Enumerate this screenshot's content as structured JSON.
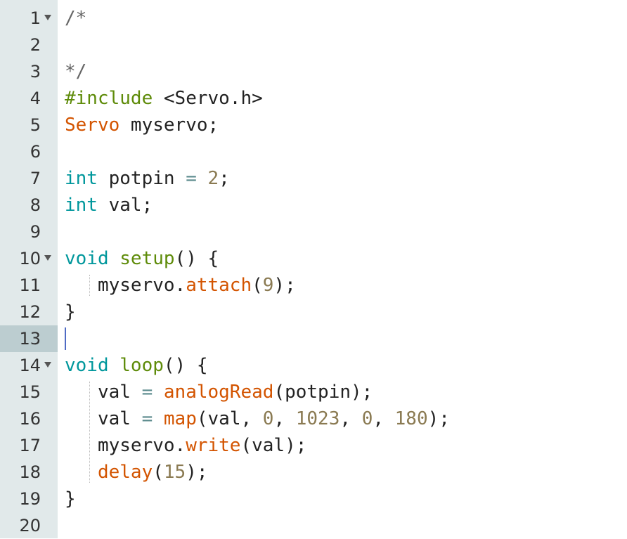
{
  "editor": {
    "lines": [
      {
        "n": "1",
        "fold": true,
        "segs": [
          {
            "t": "/*",
            "c": "comment"
          }
        ]
      },
      {
        "n": "2",
        "fold": false,
        "segs": []
      },
      {
        "n": "3",
        "fold": false,
        "segs": [
          {
            "t": "*/",
            "c": "comment"
          }
        ]
      },
      {
        "n": "4",
        "fold": false,
        "segs": [
          {
            "t": "#include",
            "c": "pre"
          },
          {
            "t": " <Servo.h>",
            "c": ""
          }
        ]
      },
      {
        "n": "5",
        "fold": false,
        "segs": [
          {
            "t": "Servo",
            "c": "type"
          },
          {
            "t": " myservo;",
            "c": ""
          }
        ]
      },
      {
        "n": "6",
        "fold": false,
        "segs": []
      },
      {
        "n": "7",
        "fold": false,
        "segs": [
          {
            "t": "int",
            "c": "kw"
          },
          {
            "t": " potpin ",
            "c": ""
          },
          {
            "t": "=",
            "c": "op"
          },
          {
            "t": " ",
            "c": ""
          },
          {
            "t": "2",
            "c": "num"
          },
          {
            "t": ";",
            "c": ""
          }
        ]
      },
      {
        "n": "8",
        "fold": false,
        "segs": [
          {
            "t": "int",
            "c": "kw"
          },
          {
            "t": " val;",
            "c": ""
          }
        ]
      },
      {
        "n": "9",
        "fold": false,
        "segs": []
      },
      {
        "n": "10",
        "fold": true,
        "segs": [
          {
            "t": "void",
            "c": "kw"
          },
          {
            "t": " ",
            "c": ""
          },
          {
            "t": "setup",
            "c": "fn"
          },
          {
            "t": "() {",
            "c": ""
          }
        ]
      },
      {
        "n": "11",
        "fold": false,
        "segs": [
          {
            "t": "   myservo.",
            "c": ""
          },
          {
            "t": "attach",
            "c": "call"
          },
          {
            "t": "(",
            "c": ""
          },
          {
            "t": "9",
            "c": "num"
          },
          {
            "t": ");",
            "c": ""
          }
        ]
      },
      {
        "n": "12",
        "fold": false,
        "segs": [
          {
            "t": "}",
            "c": ""
          }
        ]
      },
      {
        "n": "13",
        "fold": false,
        "segs": []
      },
      {
        "n": "14",
        "fold": true,
        "segs": [
          {
            "t": "void",
            "c": "kw"
          },
          {
            "t": " ",
            "c": ""
          },
          {
            "t": "loop",
            "c": "fn"
          },
          {
            "t": "() {",
            "c": ""
          }
        ]
      },
      {
        "n": "15",
        "fold": false,
        "segs": [
          {
            "t": "   val ",
            "c": ""
          },
          {
            "t": "=",
            "c": "op"
          },
          {
            "t": " ",
            "c": ""
          },
          {
            "t": "analogRead",
            "c": "call"
          },
          {
            "t": "(potpin);",
            "c": ""
          }
        ]
      },
      {
        "n": "16",
        "fold": false,
        "segs": [
          {
            "t": "   val ",
            "c": ""
          },
          {
            "t": "=",
            "c": "op"
          },
          {
            "t": " ",
            "c": ""
          },
          {
            "t": "map",
            "c": "call"
          },
          {
            "t": "(val, ",
            "c": ""
          },
          {
            "t": "0",
            "c": "num"
          },
          {
            "t": ", ",
            "c": ""
          },
          {
            "t": "1023",
            "c": "num"
          },
          {
            "t": ", ",
            "c": ""
          },
          {
            "t": "0",
            "c": "num"
          },
          {
            "t": ", ",
            "c": ""
          },
          {
            "t": "180",
            "c": "num"
          },
          {
            "t": ");",
            "c": ""
          }
        ]
      },
      {
        "n": "17",
        "fold": false,
        "segs": [
          {
            "t": "   myservo.",
            "c": ""
          },
          {
            "t": "write",
            "c": "call"
          },
          {
            "t": "(val);",
            "c": ""
          }
        ]
      },
      {
        "n": "18",
        "fold": false,
        "segs": [
          {
            "t": "   ",
            "c": ""
          },
          {
            "t": "delay",
            "c": "call"
          },
          {
            "t": "(",
            "c": ""
          },
          {
            "t": "15",
            "c": "num"
          },
          {
            "t": ");",
            "c": ""
          }
        ]
      },
      {
        "n": "19",
        "fold": false,
        "segs": [
          {
            "t": "}",
            "c": ""
          }
        ]
      },
      {
        "n": "20",
        "fold": false,
        "segs": []
      }
    ],
    "active_line": "13"
  },
  "colors": {
    "gutter": "#e1e9ea",
    "active_gutter": "#bccdd0",
    "comment": "#666666",
    "preprocessor": "#5e8b09",
    "type": "#d35400",
    "keyword": "#00979c",
    "function": "#5e8b09",
    "number": "#8a7a52",
    "call": "#d35400",
    "cursor": "#4f6bc4"
  }
}
